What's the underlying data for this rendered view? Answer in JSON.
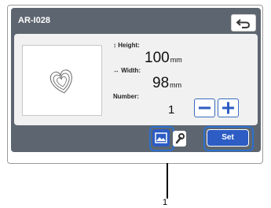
{
  "screen": {
    "pattern_name": "AR-I028",
    "back_icon": "undo-arrow-icon"
  },
  "preview": {
    "icon": "heart-outline-icon"
  },
  "dimensions": {
    "height_label": "Height:",
    "height_icon": "vertical-arrow-icon",
    "height_value": "100",
    "height_unit": "mm",
    "width_label": "Width:",
    "width_icon": "horizontal-arrow-icon",
    "width_value": "98",
    "width_unit": "mm",
    "number_label": "Number:",
    "number_value": "1"
  },
  "stepper": {
    "minus_icon": "minus-icon",
    "plus_icon": "plus-icon"
  },
  "footer": {
    "pattern_layout_icon": "image-icon",
    "wrench_icon": "wrench-icon",
    "set_label": "Set"
  },
  "callout": {
    "label": "1"
  },
  "colors": {
    "screen_bg": "#5d6670",
    "panel_bg": "#f1f1f1",
    "accent_blue": "#2c5cc4",
    "highlight_blue": "#2c6fd1"
  }
}
